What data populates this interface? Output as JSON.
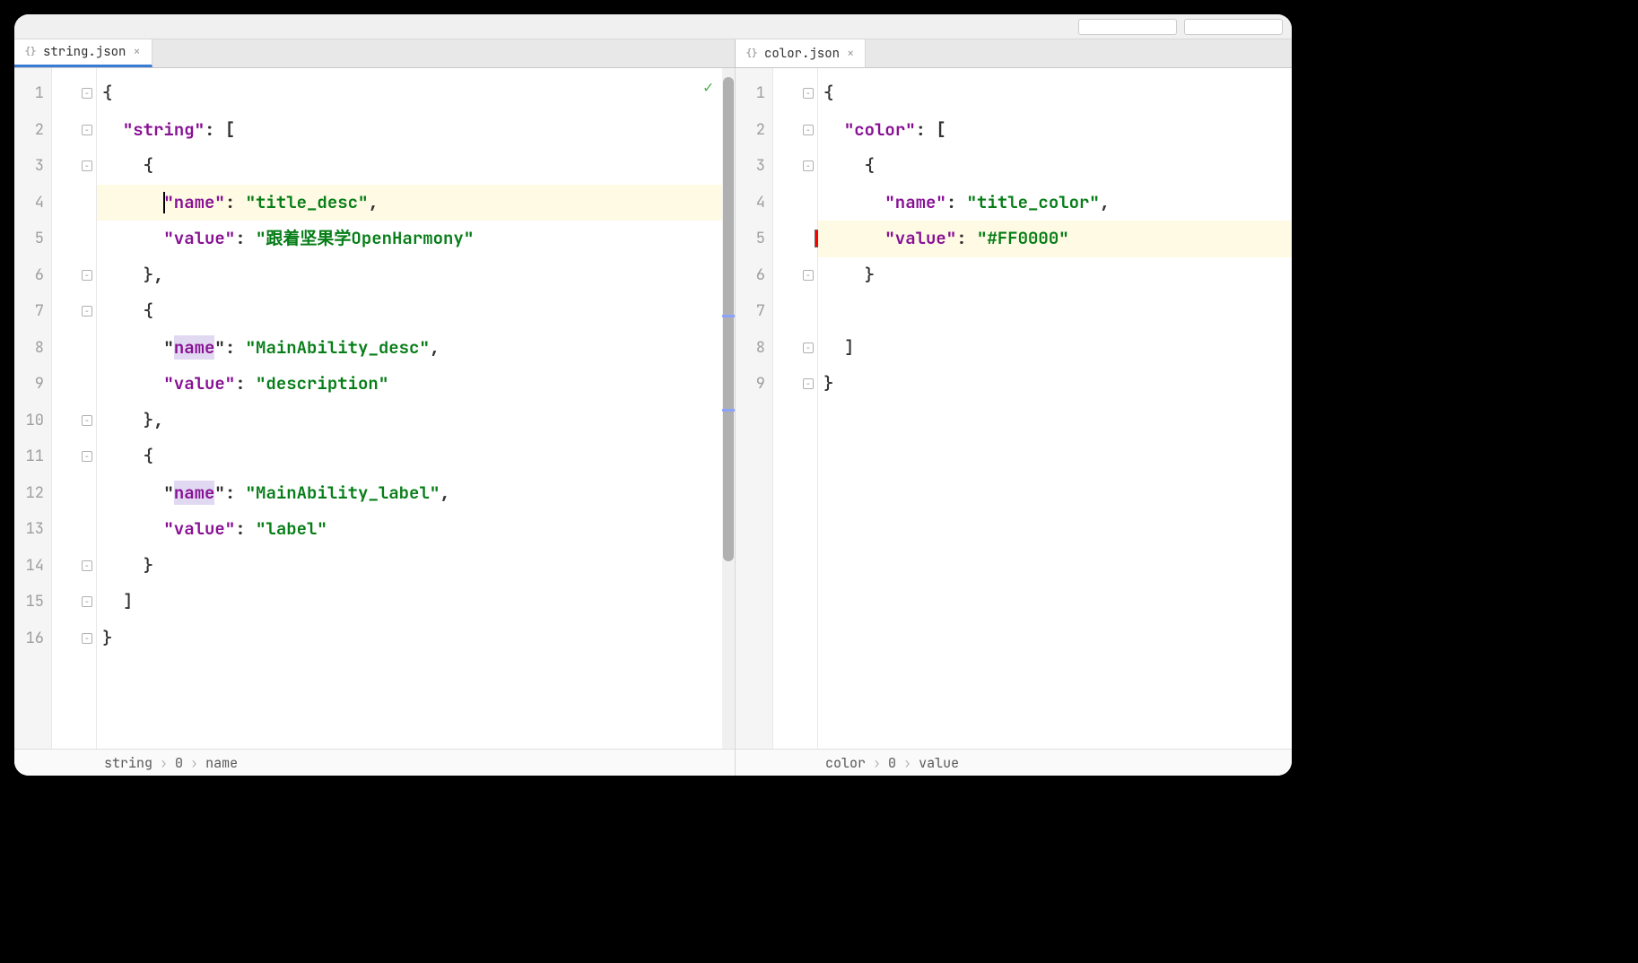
{
  "tabs": {
    "left": {
      "filename": "string.json"
    },
    "right": {
      "filename": "color.json"
    }
  },
  "left_editor": {
    "lines": [
      {
        "num": "1",
        "indent": "",
        "tokens": [
          {
            "t": "brace",
            "v": "{"
          }
        ],
        "fold": true
      },
      {
        "num": "2",
        "indent": "  ",
        "tokens": [
          {
            "t": "key",
            "v": "\"string\""
          },
          {
            "t": "punct",
            "v": ": ["
          }
        ],
        "fold": true
      },
      {
        "num": "3",
        "indent": "    ",
        "tokens": [
          {
            "t": "brace",
            "v": "{"
          }
        ],
        "fold": true
      },
      {
        "num": "4",
        "indent": "      ",
        "tokens": [
          {
            "t": "cursor"
          },
          {
            "t": "key",
            "v": "\"name\""
          },
          {
            "t": "punct",
            "v": ": "
          },
          {
            "t": "str",
            "v": "\"title_desc\""
          },
          {
            "t": "punct",
            "v": ","
          }
        ],
        "highlight": true,
        "bulb": true
      },
      {
        "num": "5",
        "indent": "      ",
        "tokens": [
          {
            "t": "key",
            "v": "\"value\""
          },
          {
            "t": "punct",
            "v": ": "
          },
          {
            "t": "str",
            "v": "\"跟着坚果学OpenHarmony\""
          }
        ]
      },
      {
        "num": "6",
        "indent": "    ",
        "tokens": [
          {
            "t": "brace",
            "v": "}"
          },
          {
            "t": "punct",
            "v": ","
          }
        ],
        "fold": true
      },
      {
        "num": "7",
        "indent": "    ",
        "tokens": [
          {
            "t": "brace",
            "v": "{"
          }
        ],
        "fold": true
      },
      {
        "num": "8",
        "indent": "      ",
        "tokens": [
          {
            "t": "punct",
            "v": "\""
          },
          {
            "t": "key-hl",
            "v": "name"
          },
          {
            "t": "punct",
            "v": "\""
          },
          {
            "t": "punct",
            "v": ": "
          },
          {
            "t": "str",
            "v": "\"MainAbility_desc\""
          },
          {
            "t": "punct",
            "v": ","
          }
        ]
      },
      {
        "num": "9",
        "indent": "      ",
        "tokens": [
          {
            "t": "key",
            "v": "\"value\""
          },
          {
            "t": "punct",
            "v": ": "
          },
          {
            "t": "str",
            "v": "\"description\""
          }
        ]
      },
      {
        "num": "10",
        "indent": "    ",
        "tokens": [
          {
            "t": "brace",
            "v": "}"
          },
          {
            "t": "punct",
            "v": ","
          }
        ],
        "fold": true
      },
      {
        "num": "11",
        "indent": "    ",
        "tokens": [
          {
            "t": "brace",
            "v": "{"
          }
        ],
        "fold": true
      },
      {
        "num": "12",
        "indent": "      ",
        "tokens": [
          {
            "t": "punct",
            "v": "\""
          },
          {
            "t": "key-hl",
            "v": "name"
          },
          {
            "t": "punct",
            "v": "\""
          },
          {
            "t": "punct",
            "v": ": "
          },
          {
            "t": "str",
            "v": "\"MainAbility_label\""
          },
          {
            "t": "punct",
            "v": ","
          }
        ]
      },
      {
        "num": "13",
        "indent": "      ",
        "tokens": [
          {
            "t": "key",
            "v": "\"value\""
          },
          {
            "t": "punct",
            "v": ": "
          },
          {
            "t": "str",
            "v": "\"label\""
          }
        ]
      },
      {
        "num": "14",
        "indent": "    ",
        "tokens": [
          {
            "t": "brace",
            "v": "}"
          }
        ],
        "fold": true
      },
      {
        "num": "15",
        "indent": "  ",
        "tokens": [
          {
            "t": "brace",
            "v": "]"
          }
        ],
        "fold": true
      },
      {
        "num": "16",
        "indent": "",
        "tokens": [
          {
            "t": "brace",
            "v": "}"
          }
        ],
        "fold": true
      }
    ],
    "breadcrumb": [
      "string",
      "0",
      "name"
    ]
  },
  "right_editor": {
    "lines": [
      {
        "num": "1",
        "indent": "",
        "tokens": [
          {
            "t": "brace",
            "v": "{"
          }
        ],
        "fold": true
      },
      {
        "num": "2",
        "indent": "  ",
        "tokens": [
          {
            "t": "key",
            "v": "\"color\""
          },
          {
            "t": "punct",
            "v": ": ["
          }
        ],
        "fold": true
      },
      {
        "num": "3",
        "indent": "    ",
        "tokens": [
          {
            "t": "brace",
            "v": "{"
          }
        ],
        "fold": true
      },
      {
        "num": "4",
        "indent": "      ",
        "tokens": [
          {
            "t": "key",
            "v": "\"name\""
          },
          {
            "t": "punct",
            "v": ": "
          },
          {
            "t": "str",
            "v": "\"title_color\""
          },
          {
            "t": "punct",
            "v": ","
          }
        ]
      },
      {
        "num": "5",
        "indent": "      ",
        "tokens": [
          {
            "t": "key",
            "v": "\"value\""
          },
          {
            "t": "punct",
            "v": ": "
          },
          {
            "t": "str",
            "v": "\"#FF0000\""
          }
        ],
        "highlight": true,
        "swatch": "#FF0000"
      },
      {
        "num": "6",
        "indent": "    ",
        "tokens": [
          {
            "t": "brace",
            "v": "}"
          }
        ],
        "fold": true
      },
      {
        "num": "7",
        "indent": "",
        "tokens": []
      },
      {
        "num": "8",
        "indent": "  ",
        "tokens": [
          {
            "t": "brace",
            "v": "]"
          }
        ],
        "fold": true
      },
      {
        "num": "9",
        "indent": "",
        "tokens": [
          {
            "t": "brace",
            "v": "}"
          }
        ],
        "fold": true
      }
    ],
    "breadcrumb": [
      "color",
      "0",
      "value"
    ]
  },
  "file_content": {
    "string_json": {
      "string": [
        {
          "name": "title_desc",
          "value": "跟着坚果学OpenHarmony"
        },
        {
          "name": "MainAbility_desc",
          "value": "description"
        },
        {
          "name": "MainAbility_label",
          "value": "label"
        }
      ]
    },
    "color_json": {
      "color": [
        {
          "name": "title_color",
          "value": "#FF0000"
        }
      ]
    }
  }
}
